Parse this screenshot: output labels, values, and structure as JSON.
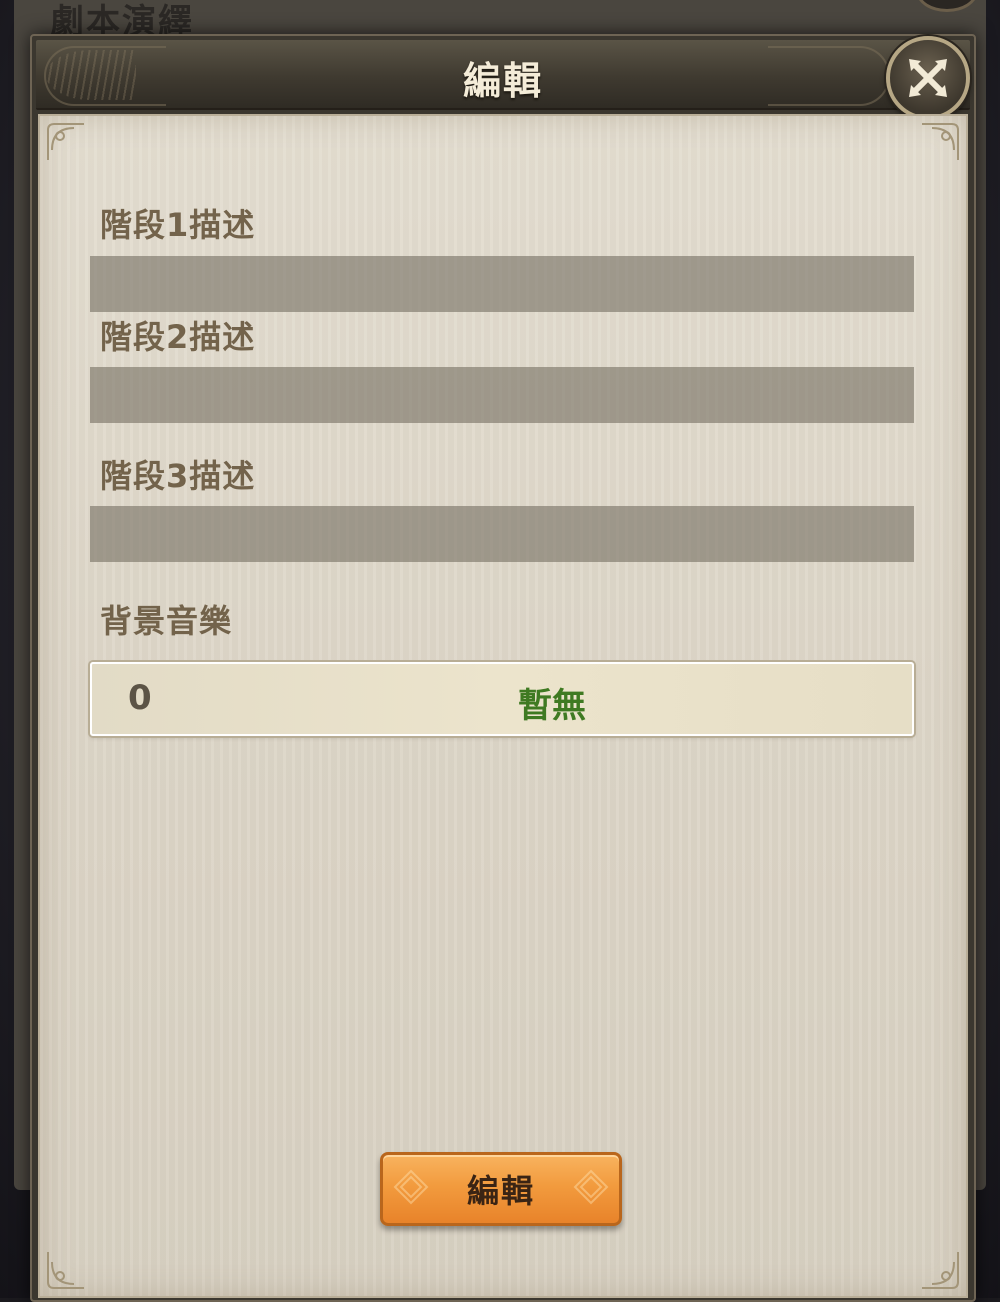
{
  "background_window": {
    "title": "劇本演繹"
  },
  "dialog": {
    "title": "編輯",
    "close_icon": "close-icon",
    "fields": [
      {
        "label": "階段1描述",
        "value": ""
      },
      {
        "label": "階段2描述",
        "value": ""
      },
      {
        "label": "階段3描述",
        "value": ""
      }
    ],
    "music": {
      "label": "背景音樂",
      "id": "0",
      "name": "暫無"
    },
    "confirm_button": "編輯"
  },
  "colors": {
    "title_text": "#f4ecd8",
    "label_text": "#73634b",
    "music_name": "#3f7a22",
    "button_orange": "#f29b3e",
    "panel_bg": "#ddd6c8"
  }
}
